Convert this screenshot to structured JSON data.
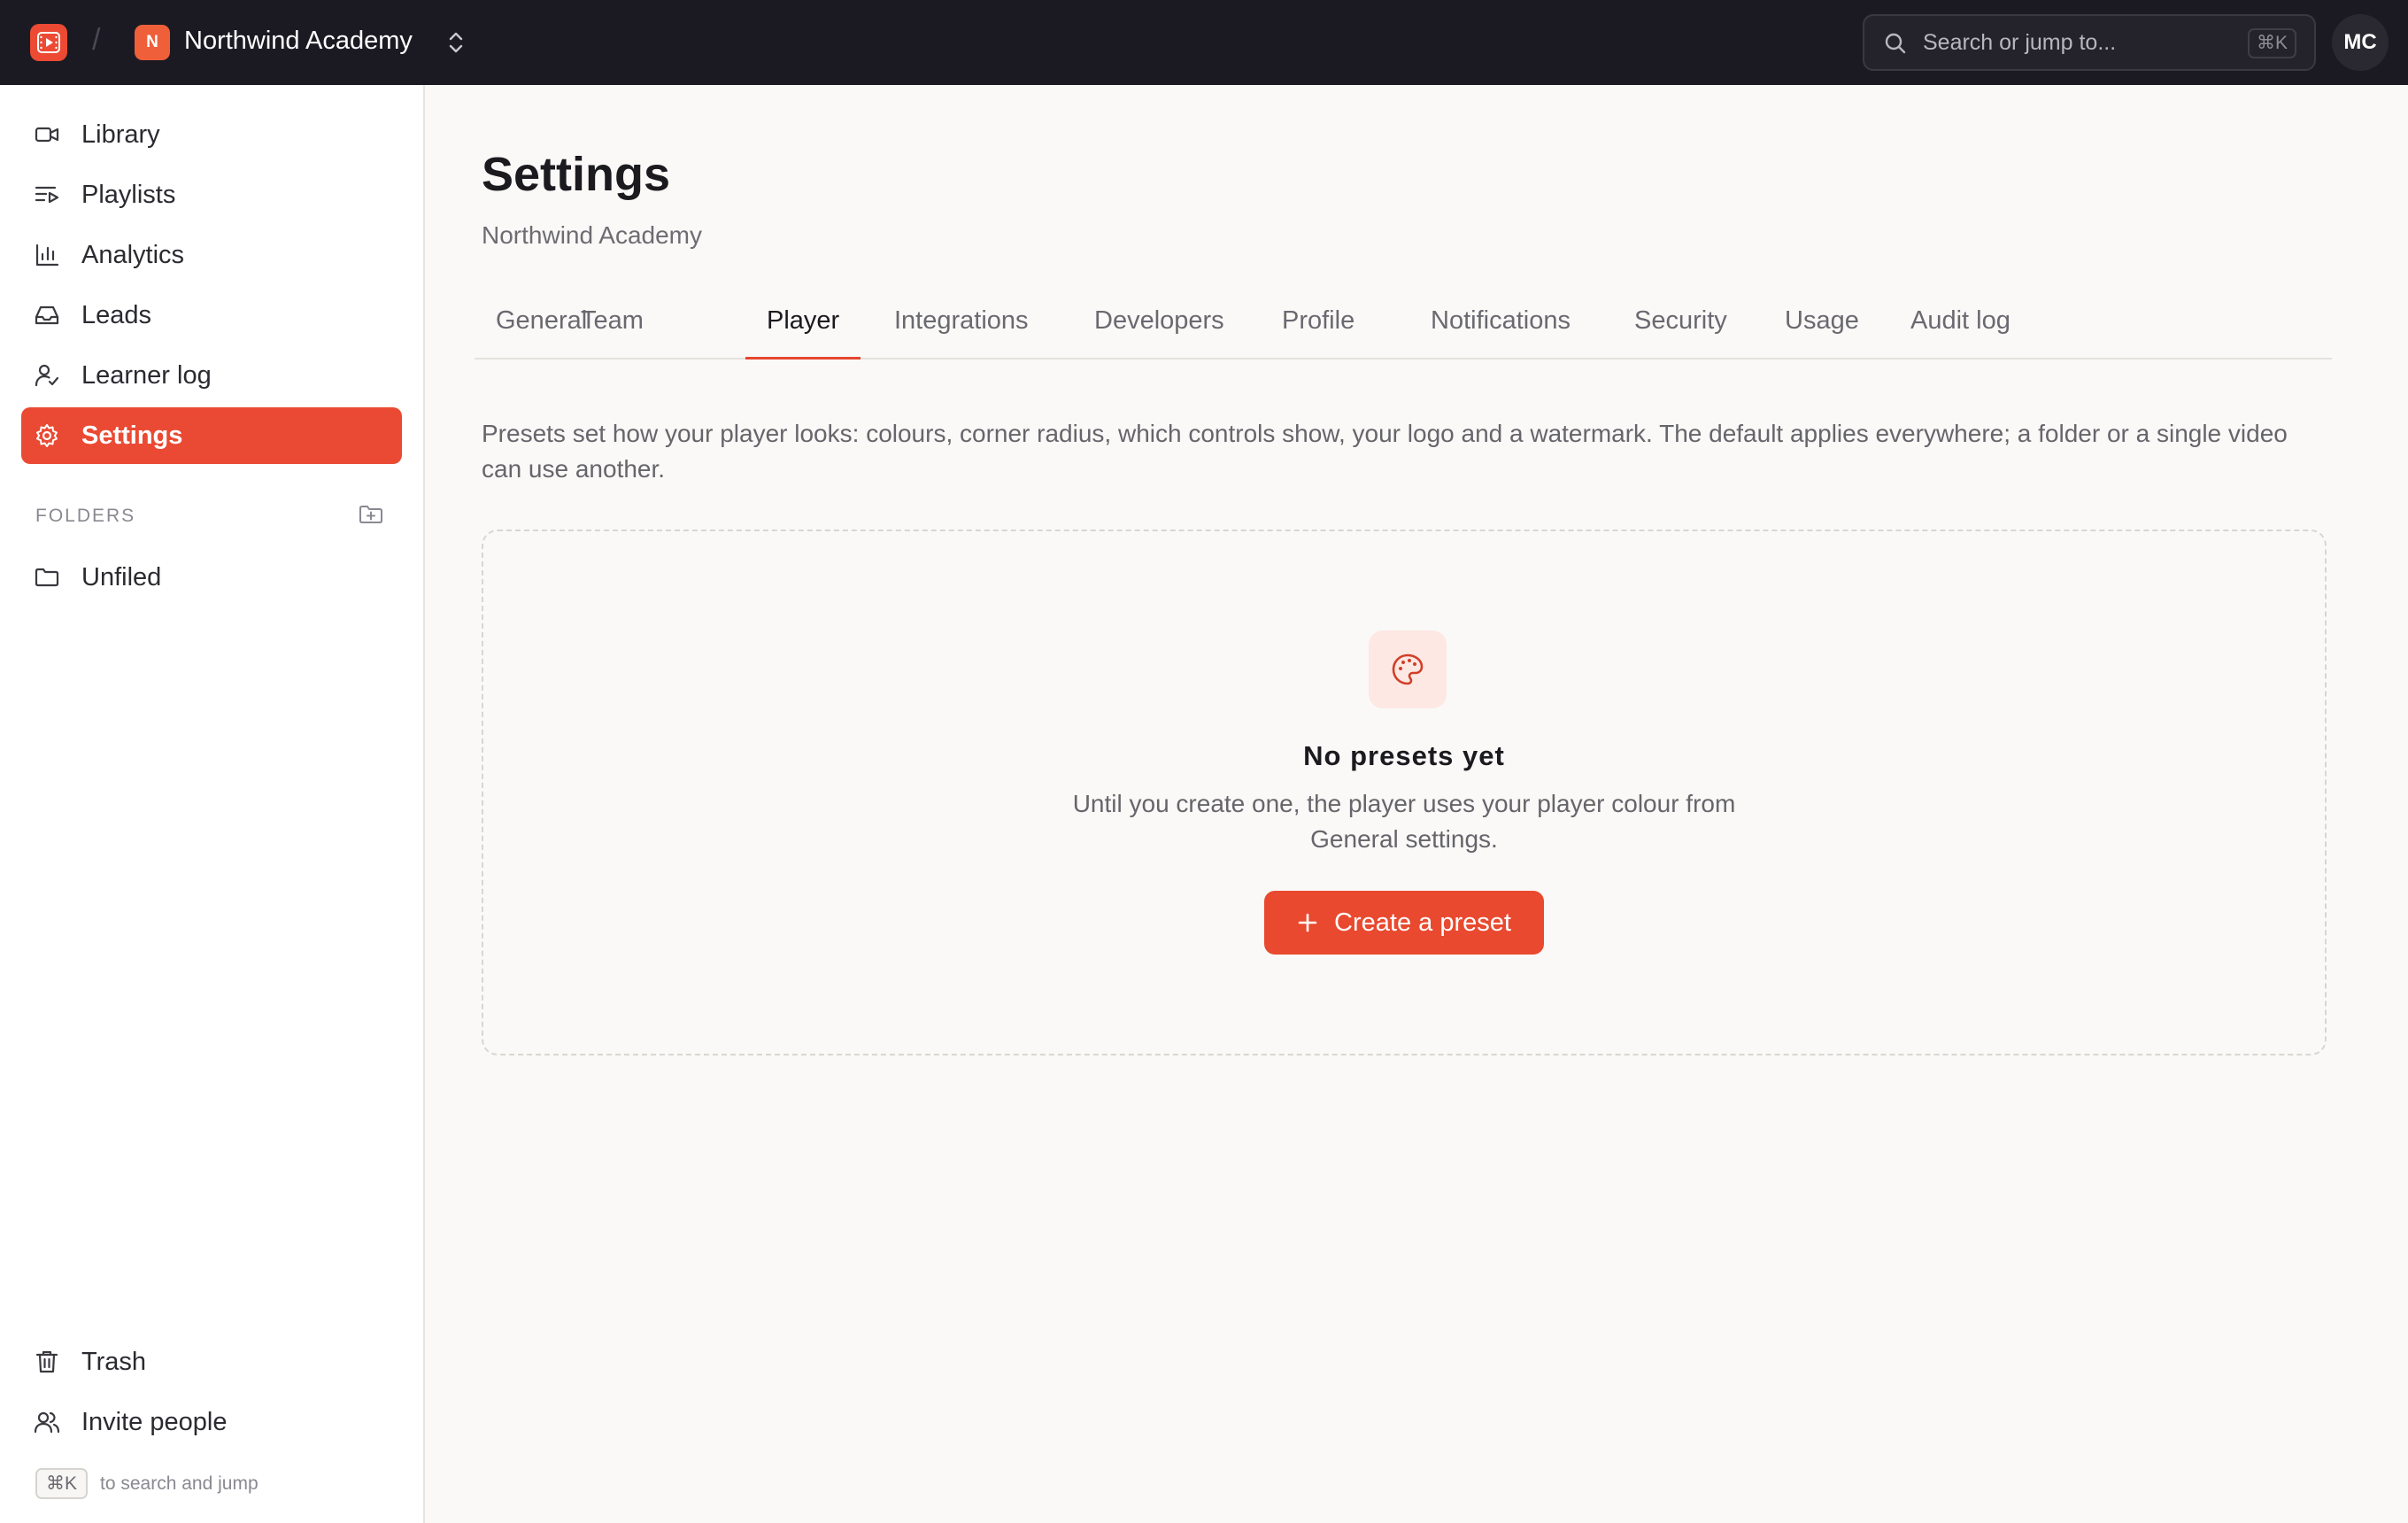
{
  "topbar": {
    "breadcrumb_separator": "/",
    "workspace_initial": "N",
    "workspace_name": "Northwind Academy",
    "search_placeholder": "Search or jump to...",
    "search_shortcut": "⌘K",
    "user_initials": "MC",
    "accent": "#ec4a33"
  },
  "sidebar": {
    "items": [
      {
        "label": "Library",
        "icon": "video-icon"
      },
      {
        "label": "Playlists",
        "icon": "playlist-icon"
      },
      {
        "label": "Analytics",
        "icon": "bar-chart-icon"
      },
      {
        "label": "Leads",
        "icon": "inbox-icon"
      },
      {
        "label": "Learner log",
        "icon": "user-check-icon"
      },
      {
        "label": "Settings",
        "icon": "gear-icon",
        "active": true
      }
    ],
    "folders_heading": "FOLDERS",
    "folders": [
      {
        "label": "Unfiled",
        "icon": "folder-icon"
      }
    ],
    "bottom_items": [
      {
        "label": "Trash",
        "icon": "trash-icon"
      },
      {
        "label": "Invite people",
        "icon": "users-icon"
      }
    ],
    "shortcut_key": "⌘K",
    "shortcut_hint": "to search and jump"
  },
  "main": {
    "title": "Settings",
    "subtitle": "Northwind Academy",
    "tabs": [
      {
        "label": "General"
      },
      {
        "label": "Team"
      },
      {
        "label": "Player",
        "active": true
      },
      {
        "label": "Integrations"
      },
      {
        "label": "Developers"
      },
      {
        "label": "Profile"
      },
      {
        "label": "Notifications"
      },
      {
        "label": "Security"
      },
      {
        "label": "Usage"
      },
      {
        "label": "Audit log"
      }
    ],
    "description": "Presets set how your player looks: colours, corner radius, which controls show, your logo and a watermark. The default applies everywhere; a folder or a single video can use another.",
    "empty_state": {
      "icon": "palette-icon",
      "title": "No presets yet",
      "text": "Until you create one, the player uses your player colour from General settings.",
      "button_label": "Create a preset"
    }
  }
}
